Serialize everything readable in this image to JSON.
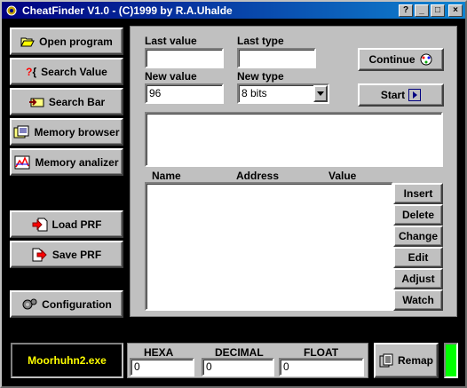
{
  "window": {
    "title": "CheatFinder V1.0 - (C)1999 by R.A.Uhalde"
  },
  "titlebar_buttons": {
    "help": "?",
    "minimize": "_",
    "maximize": "□",
    "close": "×"
  },
  "sidebar": {
    "open_program": "Open program",
    "search_value": "Search Value",
    "search_bar": "Search Bar",
    "memory_browser": "Memory browser",
    "memory_analizer": "Memory analizer",
    "load_prf": "Load PRF",
    "save_prf": "Save PRF",
    "configuration": "Configuration"
  },
  "search": {
    "last_value_label": "Last value",
    "last_value": "",
    "last_type_label": "Last type",
    "last_type": "",
    "new_value_label": "New value",
    "new_value": "96",
    "new_type_label": "New type",
    "new_type": "8 bits"
  },
  "actions": {
    "continue": "Continue",
    "start": "Start"
  },
  "results": {
    "columns": [
      "Name",
      "Address",
      "Value"
    ],
    "rows": []
  },
  "list_buttons": {
    "insert": "Insert",
    "delete": "Delete",
    "change": "Change",
    "edit": "Edit",
    "adjust": "Adjust",
    "watch": "Watch"
  },
  "status": {
    "process": "Moorhuhn2.exe",
    "hexa_label": "HEXA",
    "hexa_value": "0",
    "decimal_label": "DECIMAL",
    "decimal_value": "0",
    "float_label": "FLOAT",
    "float_value": "0",
    "remap": "Remap",
    "indicator_color": "#00ff00"
  }
}
